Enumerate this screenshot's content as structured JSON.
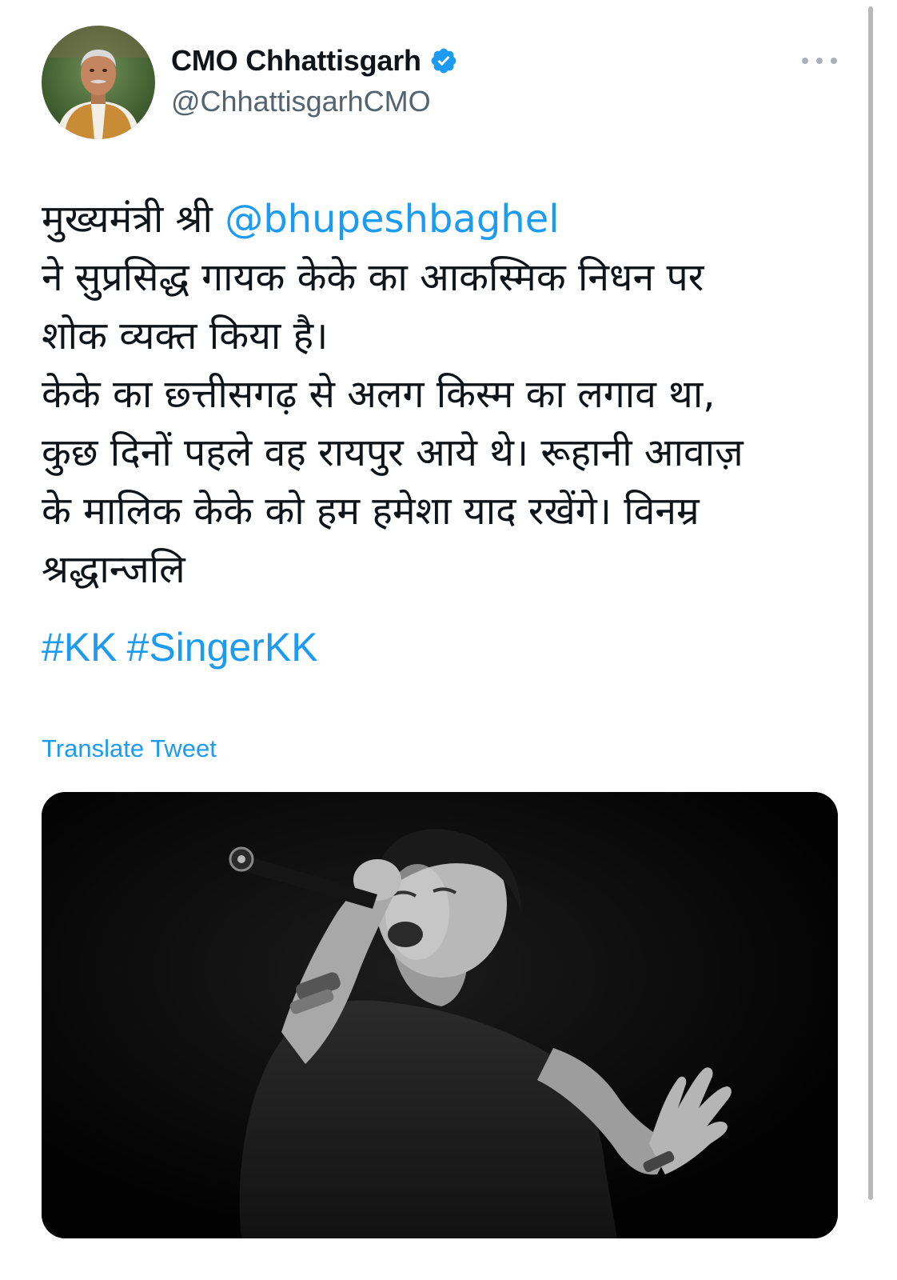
{
  "author": {
    "display_name": "CMO Chhattisgarh",
    "handle": "@ChhattisgarhCMO",
    "verified": true,
    "avatar_icon": "profile-photo",
    "verified_icon": "verified-badge-icon",
    "more_icon": "more-options-icon"
  },
  "tweet": {
    "line1_text": "मुख्यमंत्री श्री ",
    "mention": "@bhupeshbaghel",
    "line2": "ने सुप्रसिद्ध गायक केके का आकस्मिक निधन पर",
    "line3": "शोक व्यक्त किया है।",
    "line4": "केके का छ्त्तीसगढ़ से अलग किस्म का लगाव था,",
    "line5": "कुछ दिनों पहले वह रायपुर आये थे। रूहानी आवाज़",
    "line6": "के मालिक केके को हम हमेशा याद  रखेंगे। विनम्र",
    "line7": "श्रद्धान्जलि",
    "hashtags": [
      "#KK",
      "#SingerKK"
    ],
    "translate_label": "Translate Tweet"
  },
  "media": {
    "type": "photo",
    "description_icon": "singer-photo"
  },
  "colors": {
    "link": "#1d9bf0",
    "text": "#0f1419",
    "secondary": "#536471",
    "verified": "#1d9bf0"
  }
}
